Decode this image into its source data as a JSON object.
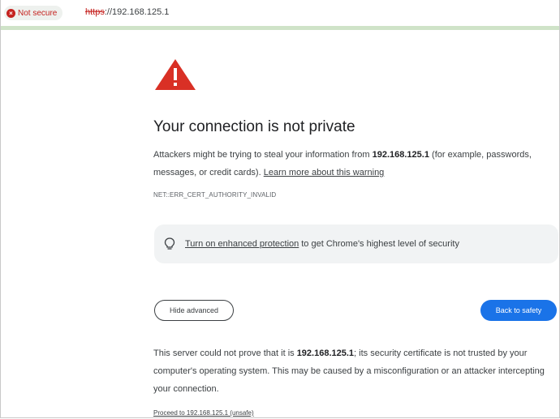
{
  "address_bar": {
    "security_chip": "Not secure",
    "url_scheme": "https",
    "url_rest": "://192.168.125.1"
  },
  "page": {
    "title": "Your connection is not private",
    "intro_prefix": "Attackers might be trying to steal your information from ",
    "intro_host": "192.168.125.1",
    "intro_suffix": " (for example, passwords, messages, or credit cards). ",
    "learn_more": "Learn more about this warning",
    "error_code": "NET::ERR_CERT_AUTHORITY_INVALID",
    "enhanced_link": "Turn on enhanced protection",
    "enhanced_rest": "to get Chrome's highest level of security",
    "hide_advanced": "Hide advanced",
    "back_to_safety": "Back to safety",
    "details_prefix": "This server could not prove that it is ",
    "details_host": "192.168.125.1",
    "details_suffix": "; its security certificate is not trusted by your computer's operating system. This may be caused by a misconfiguration or an attacker intercepting your connection.",
    "proceed_link": "Proceed to 192.168.125.1 (unsafe)"
  },
  "colors": {
    "danger": "#c5221f",
    "warning_icon": "#d93025",
    "primary_button": "#1a73e8"
  },
  "icons": [
    "warning-triangle-icon",
    "not-secure-icon",
    "lightbulb-icon"
  ]
}
